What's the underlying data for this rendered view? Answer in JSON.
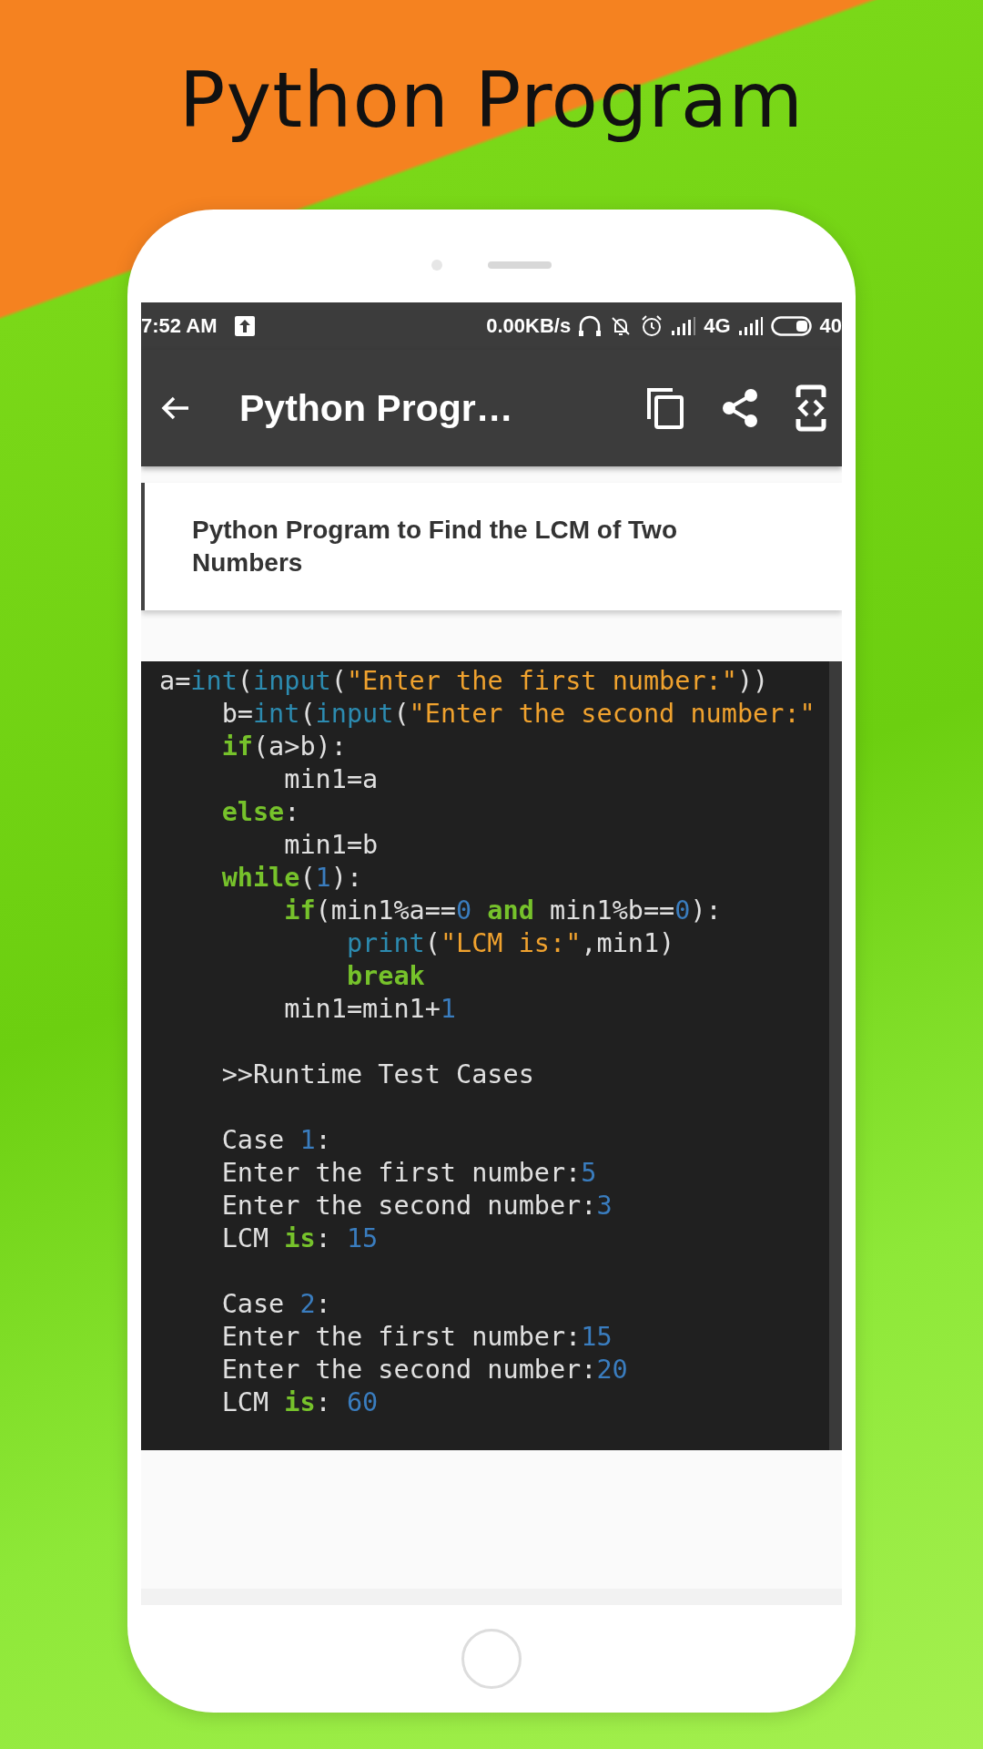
{
  "headline": "Python Program",
  "status_bar": {
    "time": "7:52 AM",
    "net_speed": "0.00KB/s",
    "network": "4G",
    "battery": "40"
  },
  "app_bar": {
    "title": "Python Progr…"
  },
  "article": {
    "title": "Python Program to Find the LCM of Two Numbers"
  },
  "code": {
    "lines": [
      {
        "kind": "code",
        "tokens": [
          {
            "kind": "plain",
            "text": "a="
          },
          {
            "kind": "builtin",
            "text": "int"
          },
          {
            "kind": "plain",
            "text": "("
          },
          {
            "kind": "builtin",
            "text": "input"
          },
          {
            "kind": "plain",
            "text": "("
          },
          {
            "kind": "string",
            "text": "\"Enter the first number:\""
          },
          {
            "kind": "plain",
            "text": "))"
          }
        ]
      },
      {
        "kind": "code",
        "tokens": [
          {
            "kind": "plain",
            "text": "    b="
          },
          {
            "kind": "builtin",
            "text": "int"
          },
          {
            "kind": "plain",
            "text": "("
          },
          {
            "kind": "builtin",
            "text": "input"
          },
          {
            "kind": "plain",
            "text": "("
          },
          {
            "kind": "string",
            "text": "\"Enter the second number:\""
          }
        ]
      },
      {
        "kind": "code",
        "tokens": [
          {
            "kind": "keyword",
            "text": "    if"
          },
          {
            "kind": "plain",
            "text": "(a>b):"
          }
        ]
      },
      {
        "kind": "code",
        "tokens": [
          {
            "kind": "plain",
            "text": "        min1=a"
          }
        ]
      },
      {
        "kind": "code",
        "tokens": [
          {
            "kind": "keyword",
            "text": "    else"
          },
          {
            "kind": "plain",
            "text": ":"
          }
        ]
      },
      {
        "kind": "code",
        "tokens": [
          {
            "kind": "plain",
            "text": "        min1=b"
          }
        ]
      },
      {
        "kind": "code",
        "tokens": [
          {
            "kind": "keyword",
            "text": "    while"
          },
          {
            "kind": "plain",
            "text": "("
          },
          {
            "kind": "number",
            "text": "1"
          },
          {
            "kind": "plain",
            "text": "):"
          }
        ]
      },
      {
        "kind": "code",
        "tokens": [
          {
            "kind": "keyword",
            "text": "        if"
          },
          {
            "kind": "plain",
            "text": "(min1%a=="
          },
          {
            "kind": "number",
            "text": "0"
          },
          {
            "kind": "keyword",
            "text": " and"
          },
          {
            "kind": "plain",
            "text": " min1%b=="
          },
          {
            "kind": "number",
            "text": "0"
          },
          {
            "kind": "plain",
            "text": "):"
          }
        ]
      },
      {
        "kind": "code",
        "tokens": [
          {
            "kind": "builtin",
            "text": "            print"
          },
          {
            "kind": "plain",
            "text": "("
          },
          {
            "kind": "string",
            "text": "\"LCM is:\""
          },
          {
            "kind": "plain",
            "text": ",min1)"
          }
        ]
      },
      {
        "kind": "code",
        "tokens": [
          {
            "kind": "keyword",
            "text": "            break"
          }
        ]
      },
      {
        "kind": "code",
        "tokens": [
          {
            "kind": "plain",
            "text": "        min1=min1+"
          },
          {
            "kind": "number",
            "text": "1"
          }
        ]
      },
      {
        "kind": "blank"
      },
      {
        "kind": "code",
        "tokens": [
          {
            "kind": "plain",
            "text": "    >>Runtime Test Cases"
          }
        ]
      },
      {
        "kind": "blank"
      },
      {
        "kind": "code",
        "tokens": [
          {
            "kind": "plain",
            "text": "    Case "
          },
          {
            "kind": "number",
            "text": "1"
          },
          {
            "kind": "plain",
            "text": ":"
          }
        ]
      },
      {
        "kind": "code",
        "tokens": [
          {
            "kind": "plain",
            "text": "    Enter the first number:"
          },
          {
            "kind": "number",
            "text": "5"
          }
        ]
      },
      {
        "kind": "code",
        "tokens": [
          {
            "kind": "plain",
            "text": "    Enter the second number:"
          },
          {
            "kind": "number",
            "text": "3"
          }
        ]
      },
      {
        "kind": "code",
        "tokens": [
          {
            "kind": "plain",
            "text": "    LCM "
          },
          {
            "kind": "keyword",
            "text": "is"
          },
          {
            "kind": "plain",
            "text": ": "
          },
          {
            "kind": "number",
            "text": "15"
          }
        ]
      },
      {
        "kind": "blank"
      },
      {
        "kind": "code",
        "tokens": [
          {
            "kind": "plain",
            "text": "    Case "
          },
          {
            "kind": "number",
            "text": "2"
          },
          {
            "kind": "plain",
            "text": ":"
          }
        ]
      },
      {
        "kind": "code",
        "tokens": [
          {
            "kind": "plain",
            "text": "    Enter the first number:"
          },
          {
            "kind": "number",
            "text": "15"
          }
        ]
      },
      {
        "kind": "code",
        "tokens": [
          {
            "kind": "plain",
            "text": "    Enter the second number:"
          },
          {
            "kind": "number",
            "text": "20"
          }
        ]
      },
      {
        "kind": "code",
        "tokens": [
          {
            "kind": "plain",
            "text": "    LCM "
          },
          {
            "kind": "keyword",
            "text": "is"
          },
          {
            "kind": "plain",
            "text": ": "
          },
          {
            "kind": "number",
            "text": "60"
          }
        ]
      }
    ]
  }
}
